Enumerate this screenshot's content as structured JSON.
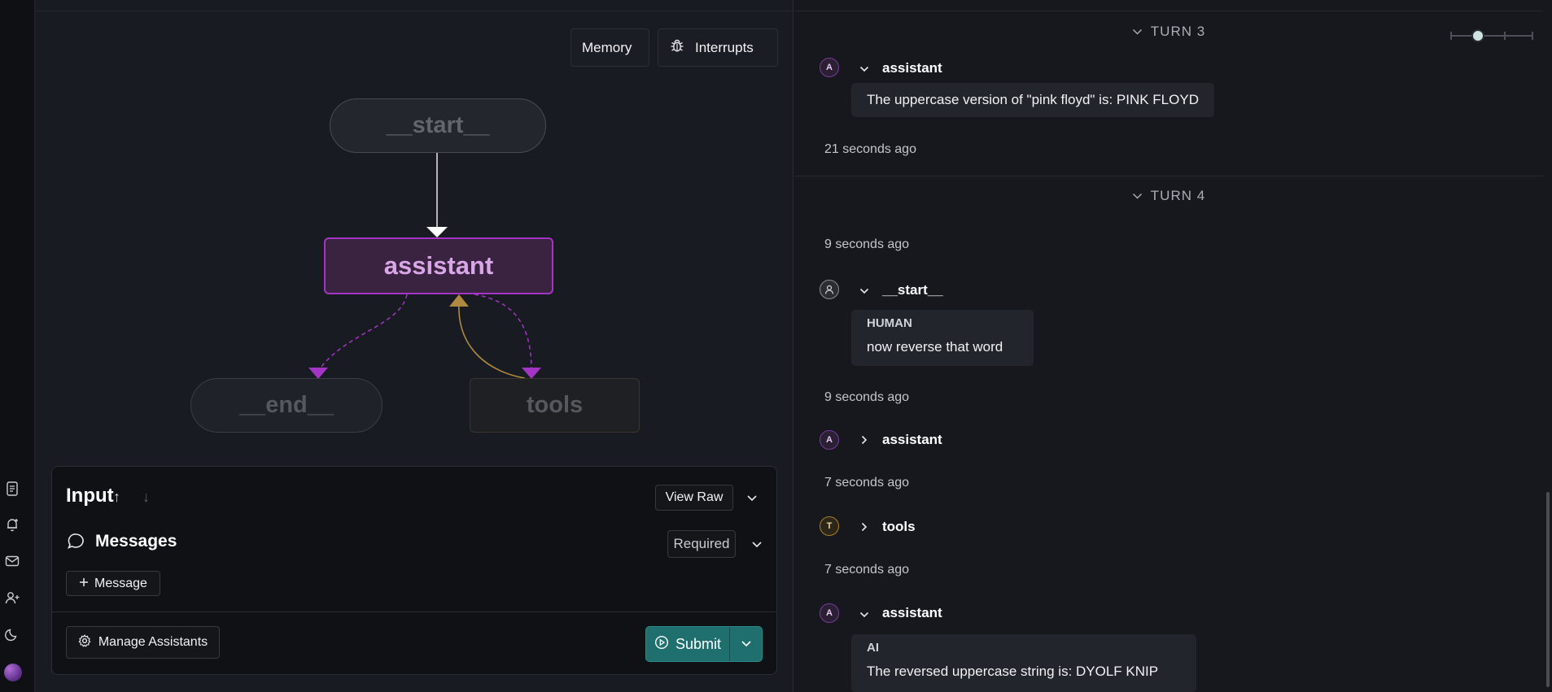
{
  "graph": {
    "memory_label": "Memory",
    "interrupts_label": "Interrupts",
    "nodes": {
      "start": "__start__",
      "assistant": "assistant",
      "end": "__end__",
      "tools": "tools"
    }
  },
  "input_panel": {
    "title": "Input",
    "view_raw_label": "View Raw",
    "messages_label": "Messages",
    "required_label": "Required",
    "add_message_label": "Message",
    "manage_assistants_label": "Manage Assistants",
    "submit_label": "Submit"
  },
  "thread": {
    "turn3": {
      "label": "TURN 3",
      "assistant_name": "assistant",
      "avatar_letter": "A",
      "message": "The uppercase version of \"pink floyd\" is: PINK FLOYD",
      "timestamp": "21 seconds ago"
    },
    "turn4": {
      "label": "TURN 4",
      "timestamp1": "9 seconds ago",
      "start_name": "__start__",
      "human_role": "HUMAN",
      "human_message": "now reverse that word",
      "timestamp2": "9 seconds ago",
      "assistant_name": "assistant",
      "avatar_a": "A",
      "timestamp3": "7 seconds ago",
      "tools_name": "tools",
      "avatar_t": "T",
      "timestamp4": "7 seconds ago",
      "assistant2_name": "assistant",
      "ai_role": "AI",
      "ai_message": "The reversed uppercase string is: DYOLF KNIP"
    }
  },
  "colors": {
    "accent_purple": "#a435c4",
    "tools_edge": "#b08a3e",
    "submit_bg": "#1f6f6f"
  }
}
